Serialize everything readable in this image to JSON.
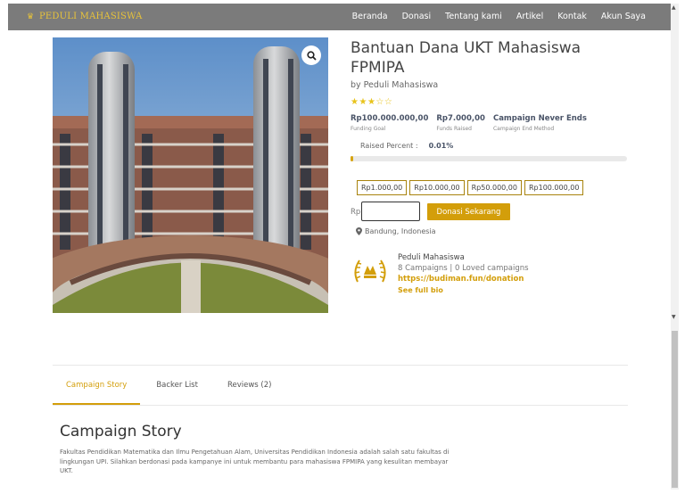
{
  "brand": {
    "name": "PEDULI MAHASISWA"
  },
  "nav": {
    "items": [
      "Beranda",
      "Donasi",
      "Tentang kami",
      "Artikel",
      "Kontak",
      "Akun Saya"
    ]
  },
  "campaign": {
    "title": "Bantuan Dana UKT Mahasiswa FPMIPA",
    "author": "by Peduli Mahasiswa",
    "rating": {
      "filled": 3,
      "total": 5
    },
    "stats": [
      {
        "value": "Rp100.000.000,00",
        "label": "Funding Goal"
      },
      {
        "value": "Rp7.000,00",
        "label": "Funds Raised"
      },
      {
        "value": "Campaign Never Ends",
        "label": "Campaign End Method"
      }
    ],
    "raised_label": "Raised Percent :",
    "raised_value": "0.01%",
    "progress_fraction": 0.01,
    "amounts": [
      "Rp1.000,00",
      "Rp10.000,00",
      "Rp50.000,00",
      "Rp100.000,00"
    ],
    "currency_prefix": "Rp",
    "donate_label": "Donasi Sekarang",
    "location": "Bandung, Indonesia"
  },
  "creator": {
    "name": "Peduli Mahasiswa",
    "counts": "8 Campaigns | 0 Loved campaigns",
    "url": "https://budiman.fun/donation",
    "full_bio": "See full bio"
  },
  "tabs": [
    "Campaign Story",
    "Backer List",
    "Reviews (2)"
  ],
  "story": {
    "heading": "Campaign Story",
    "body": "Fakultas Pendidikan Matematika dan Ilmu Pengetahuan Alam, Universitas Pendidikan Indonesia adalah salah satu fakultas di lingkungan UPI. Silahkan berdonasi pada kampanye ini untuk membantu para mahasiswa FPMIPA yang kesulitan membayar UKT."
  },
  "colors": {
    "accent": "#d39e0a",
    "nav_bg": "#7b7b7b",
    "brand": "#e8c33a"
  },
  "icons": [
    "zoom-icon",
    "location-pin-icon",
    "star-icon"
  ]
}
